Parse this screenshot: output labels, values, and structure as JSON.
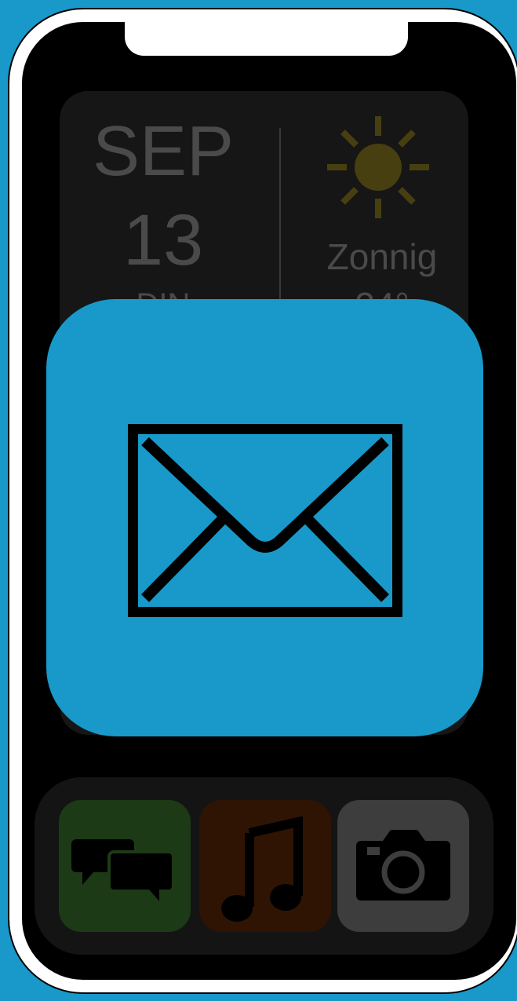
{
  "widget": {
    "date": {
      "month": "SEP",
      "day": "13",
      "weekday": "DIN"
    },
    "weather": {
      "icon": "sun-icon",
      "condition": "Zonnig",
      "temperature": "24°"
    }
  },
  "focused_app": {
    "name": "mail",
    "icon": "mail-envelope-icon",
    "color": "#1899c9"
  },
  "dock": {
    "apps": [
      {
        "name": "messages",
        "icon": "chat-bubbles-icon",
        "color": "#1d3a16"
      },
      {
        "name": "music",
        "icon": "music-note-icon",
        "color": "#2f1404"
      },
      {
        "name": "camera",
        "icon": "camera-icon",
        "color": "#3d3d3d"
      }
    ]
  },
  "colors": {
    "background": "#1899c9",
    "screen": "#000000",
    "widget": "#161616",
    "sun": "#473f10"
  }
}
